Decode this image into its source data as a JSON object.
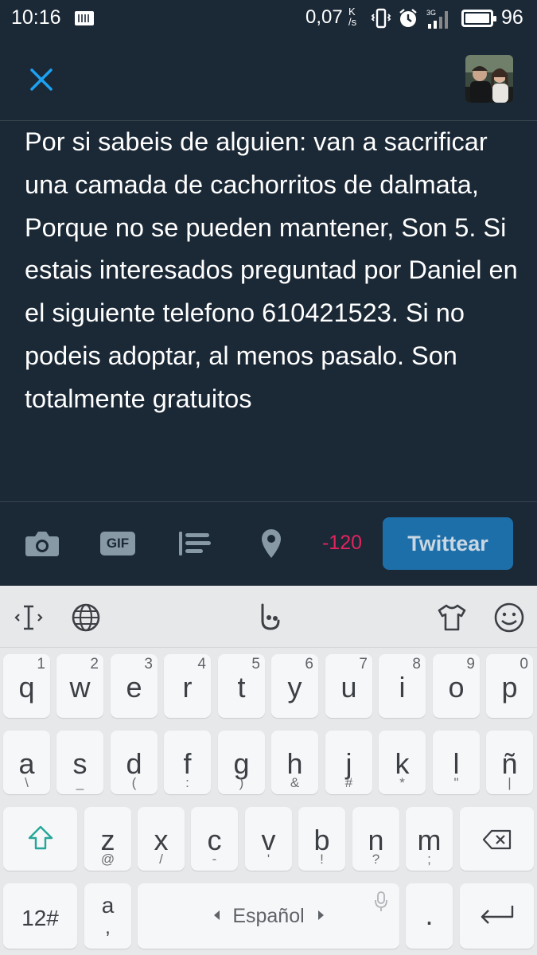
{
  "status_bar": {
    "time": "10:16",
    "net_speed": "0,07",
    "net_speed_unit_top": "K",
    "net_speed_unit_bottom": "/s",
    "network_type": "3G",
    "battery_percent": "96",
    "icons": [
      "keyboard-icon",
      "vibrate-icon",
      "alarm-icon",
      "signal-icon",
      "battery-icon"
    ]
  },
  "header": {
    "close_icon": "close-icon",
    "avatar": "profile-avatar"
  },
  "compose": {
    "text": "Por si sabeis de alguien: van a sacrificar una camada de cachorritos de dalmata, Porque no se pueden mantener, Son 5. Si estais interesados preguntad por Daniel en el siguiente telefono 610421523. Si no podeis adoptar, al menos pasalo. Son totalmente gratuitos"
  },
  "toolbar": {
    "icons": [
      "camera-icon",
      "gif-icon",
      "poll-icon",
      "location-icon"
    ],
    "gif_label": "GIF",
    "char_count": "-120",
    "char_count_color": "#e0245e",
    "tweet_button": "Twittear",
    "tweet_button_color": "#1d6faa"
  },
  "keyboard": {
    "toolbar_icons": [
      "cursor-icon",
      "globe-icon",
      "hand-icon",
      "shirt-icon",
      "emoji-icon"
    ],
    "row1": [
      {
        "main": "q",
        "num": "1"
      },
      {
        "main": "w",
        "num": "2"
      },
      {
        "main": "e",
        "num": "3"
      },
      {
        "main": "r",
        "num": "4"
      },
      {
        "main": "t",
        "num": "5"
      },
      {
        "main": "y",
        "num": "6"
      },
      {
        "main": "u",
        "num": "7"
      },
      {
        "main": "i",
        "num": "8"
      },
      {
        "main": "o",
        "num": "9"
      },
      {
        "main": "p",
        "num": "0"
      }
    ],
    "row2": [
      {
        "main": "a",
        "sub": "\\"
      },
      {
        "main": "s",
        "sub": "_"
      },
      {
        "main": "d",
        "sub": "("
      },
      {
        "main": "f",
        "sub": ":"
      },
      {
        "main": "g",
        "sub": ")"
      },
      {
        "main": "h",
        "sub": "&"
      },
      {
        "main": "j",
        "sub": "#"
      },
      {
        "main": "k",
        "sub": "*"
      },
      {
        "main": "l",
        "sub": "\""
      },
      {
        "main": "ñ",
        "sub": "|"
      }
    ],
    "row3": [
      {
        "main": "z",
        "sub": "@"
      },
      {
        "main": "x",
        "sub": "/"
      },
      {
        "main": "c",
        "sub": "-"
      },
      {
        "main": "v",
        "sub": "'"
      },
      {
        "main": "b",
        "sub": "!"
      },
      {
        "main": "n",
        "sub": "?"
      },
      {
        "main": "m",
        "sub": ";"
      }
    ],
    "symbols_key": "12#",
    "punct_key_main": "a",
    "punct_key_sub": ",",
    "space_key": "Español",
    "period_key": "."
  }
}
